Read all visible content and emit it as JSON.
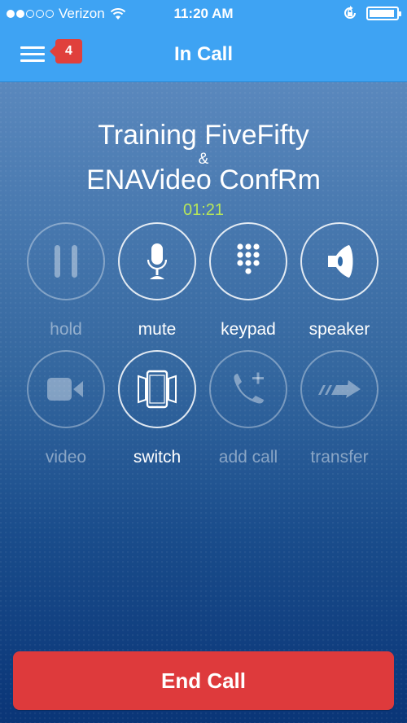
{
  "status_bar": {
    "signal_filled": 2,
    "signal_total": 5,
    "carrier": "Verizon",
    "time": "11:20 AM",
    "battery_level": 0.95,
    "icons": [
      "wifi-icon",
      "orientation-lock-icon",
      "battery-icon"
    ]
  },
  "nav": {
    "menu_icon": "hamburger-menu-icon",
    "badge_count": "4",
    "title": "In Call"
  },
  "call": {
    "participant_1": "Training FiveFifty",
    "separator": "&",
    "participant_2": "ENAVideo ConfRm",
    "duration": "01:21"
  },
  "controls": [
    {
      "label": "hold",
      "icon": "pause-icon",
      "enabled": false
    },
    {
      "label": "mute",
      "icon": "microphone-icon",
      "enabled": true
    },
    {
      "label": "keypad",
      "icon": "keypad-icon",
      "enabled": true
    },
    {
      "label": "speaker",
      "icon": "speaker-icon",
      "enabled": true
    },
    {
      "label": "video",
      "icon": "video-camera-icon",
      "enabled": false
    },
    {
      "label": "switch",
      "icon": "switch-device-icon",
      "enabled": true
    },
    {
      "label": "add call",
      "icon": "add-call-icon",
      "enabled": false
    },
    {
      "label": "transfer",
      "icon": "transfer-arrow-icon",
      "enabled": false
    }
  ],
  "end_call_label": "End Call",
  "colors": {
    "header_blue": "#3ea3f3",
    "badge_red": "#e0403c",
    "timer_green": "#b6e55a",
    "end_call_red": "#de3a3c"
  }
}
